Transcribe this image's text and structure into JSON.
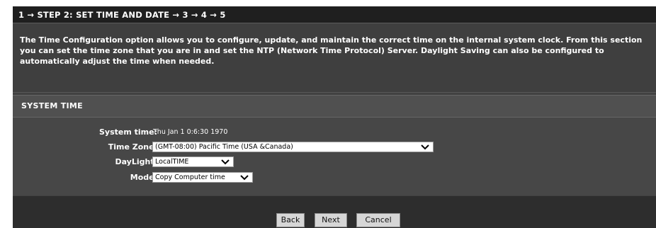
{
  "step_bar": {
    "text": "1 → STEP 2: SET TIME AND DATE → 3 → 4 → 5"
  },
  "intro": {
    "text": "The Time Configuration option allows you to configure, update, and maintain the correct time on the internal system clock. From this section you can set the time zone that you are in and set the NTP (Network Time Protocol) Server. Daylight Saving can also be configured to automatically adjust the time when needed."
  },
  "section": {
    "title": "SYSTEM TIME"
  },
  "form": {
    "system_time": {
      "label": "System time:",
      "value": "Thu Jan 1 0:6:30 1970"
    },
    "time_zone": {
      "label": "Time Zone:",
      "value": "(GMT-08:00) Pacific Time (USA &Canada)",
      "icon": "chevron-down-icon"
    },
    "daylight": {
      "label": "DayLight:",
      "value": "LocalTIME",
      "icon": "chevron-down-icon"
    },
    "mode": {
      "label": "Mode:",
      "value": "Copy Computer time",
      "icon": "chevron-down-icon"
    }
  },
  "buttons": {
    "back": "Back",
    "next": "Next",
    "cancel": "Cancel"
  },
  "colors": {
    "background": "#414141",
    "step_bar": "#1f1f1f",
    "section_header": "#505050",
    "footer": "#2d2d2d",
    "button": "#d6d6d6"
  }
}
